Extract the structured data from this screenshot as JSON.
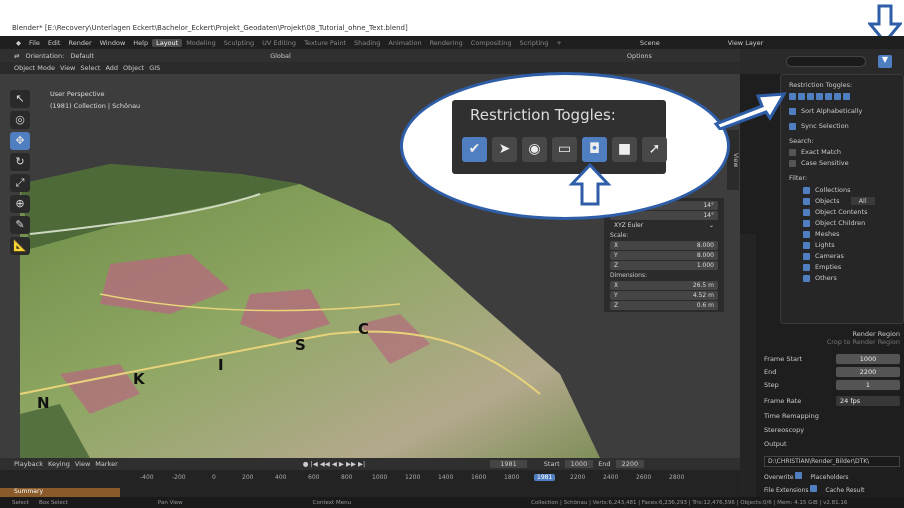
{
  "title_bar": {
    "text": "Blender* [E:\\Recovery\\Unterlagen Eckert\\Bachelor_Eckert\\Projekt_Geodaten\\Projekt\\08_Tutorial_ohne_Text.blend]"
  },
  "menu": {
    "items": [
      "File",
      "Edit",
      "Render",
      "Window",
      "Help"
    ],
    "workspaces": [
      "Layout",
      "Modeling",
      "Sculpting",
      "UV Editing",
      "Texture Paint",
      "Shading",
      "Animation",
      "Rendering",
      "Compositing",
      "Scripting",
      "+"
    ],
    "active_workspace": "Layout",
    "scene": "Scene",
    "view_layer": "View Layer"
  },
  "tool_header": {
    "orientation_label": "Orientation:",
    "orientation_value": "Default",
    "transform": "Global",
    "options": "Options"
  },
  "viewport_header": {
    "mode": "Object Mode",
    "view": "View",
    "select": "Select",
    "add": "Add",
    "object": "Object",
    "gis": "GIS"
  },
  "viewport": {
    "perspective": "User Perspective",
    "collection": "(1981) Collection | Schönau"
  },
  "n_panel": {
    "rows_top": [
      "14°",
      "14°"
    ],
    "euler": "XYZ Euler",
    "scale_label": "Scale:",
    "scale": [
      {
        "axis": "X",
        "value": "8.000"
      },
      {
        "axis": "Y",
        "value": "8.000"
      },
      {
        "axis": "Z",
        "value": "1.000"
      }
    ],
    "dimensions_label": "Dimensions:",
    "dimensions": [
      {
        "axis": "X",
        "value": "26.5 m"
      },
      {
        "axis": "Y",
        "value": "4.52 m"
      },
      {
        "axis": "Z",
        "value": "0.6 m"
      }
    ],
    "tab": "View"
  },
  "map_letters": [
    "N",
    "K",
    "I",
    "S",
    "C"
  ],
  "filter_popup": {
    "restriction_label": "Restriction Toggles:",
    "sort": "Sort Alphabetically",
    "sync": "Sync Selection",
    "search_label": "Search:",
    "exact": "Exact Match",
    "case": "Case Sensitive",
    "filter_label": "Filter:",
    "filters": [
      "Collections",
      "Objects",
      "Object Contents",
      "Object Children",
      "Meshes",
      "Lights",
      "Cameras",
      "Empties",
      "Others"
    ],
    "objects_dropdown": "All"
  },
  "callout": {
    "title": "Restriction Toggles:"
  },
  "properties": {
    "render_region": "Render Region",
    "crop": "Crop to Render Region",
    "frame_start_label": "Frame Start",
    "frame_start": "1000",
    "end_label": "End",
    "end": "2200",
    "step_label": "Step",
    "step": "1",
    "frame_rate_label": "Frame Rate",
    "frame_rate": "24 fps",
    "time_remapping": "Time Remapping",
    "stereoscopy": "Stereoscopy",
    "output": "Output",
    "output_path": "D:\\CHRISTIAN\\Render_Bilder\\DTK\\",
    "overwrite": "Overwrite",
    "placeholders": "Placeholders",
    "file_ext": "File Extensions",
    "cache": "Cache Result"
  },
  "timeline": {
    "playback": "Playback",
    "keying": "Keying",
    "view": "View",
    "marker": "Marker",
    "current": "1981",
    "start_label": "Start",
    "start": "1000",
    "end_label": "End",
    "end": "2200",
    "summary": "Summary",
    "ruler": [
      "-400",
      "-200",
      "0",
      "200",
      "400",
      "600",
      "800",
      "1000",
      "1200",
      "1400",
      "1600",
      "1800",
      "1981",
      "2200",
      "2400",
      "2600",
      "2800"
    ]
  },
  "status_bar": {
    "select": "Select",
    "box_select": "Box Select",
    "pan": "Pan View",
    "context": "Context Menu",
    "info": "Collection | Schönau | Verts:6,243,481 | Faces:6,236,293 | Tris:12,476,596 | Objects:0/6 | Mem: 4.15 GiB | v2.81.16"
  },
  "colors": {
    "accent": "#4f7fc0",
    "arrow": "#2f5ea8",
    "bg": "#3d3d3d"
  }
}
